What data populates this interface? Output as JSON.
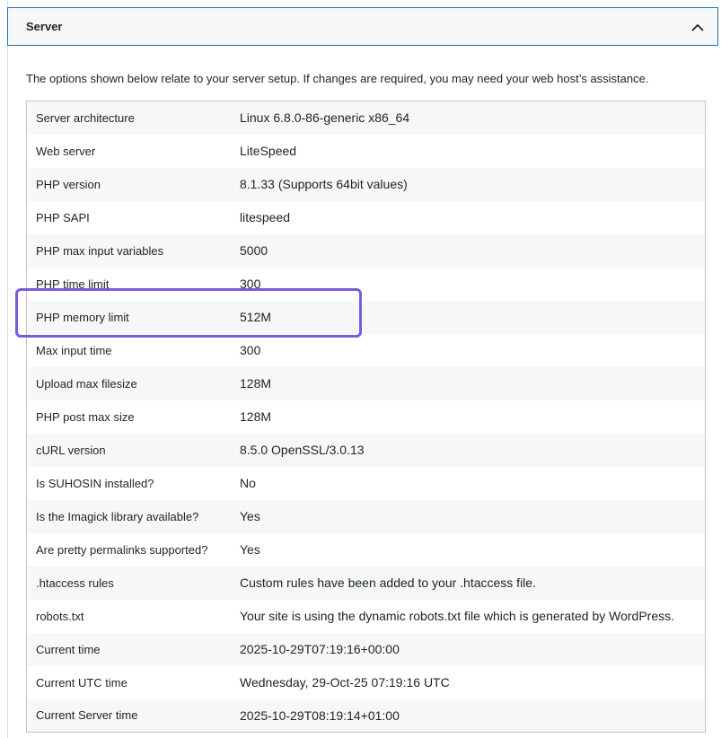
{
  "section": {
    "title": "Server",
    "toggle_icon": "chevron-up-icon"
  },
  "description": "The options shown below relate to your server setup. If changes are required, you may need your web host’s assistance.",
  "rows": [
    {
      "label": "Server architecture",
      "value": "Linux 6.8.0-86-generic x86_64"
    },
    {
      "label": "Web server",
      "value": "LiteSpeed"
    },
    {
      "label": "PHP version",
      "value": "8.1.33 (Supports 64bit values)"
    },
    {
      "label": "PHP SAPI",
      "value": "litespeed"
    },
    {
      "label": "PHP max input variables",
      "value": "5000"
    },
    {
      "label": "PHP time limit",
      "value": "300"
    },
    {
      "label": "PHP memory limit",
      "value": "512M"
    },
    {
      "label": "Max input time",
      "value": "300"
    },
    {
      "label": "Upload max filesize",
      "value": "128M"
    },
    {
      "label": "PHP post max size",
      "value": "128M"
    },
    {
      "label": "cURL version",
      "value": "8.5.0 OpenSSL/3.0.13"
    },
    {
      "label": "Is SUHOSIN installed?",
      "value": "No"
    },
    {
      "label": "Is the Imagick library available?",
      "value": "Yes"
    },
    {
      "label": "Are pretty permalinks supported?",
      "value": "Yes"
    },
    {
      "label": ".htaccess rules",
      "value": "Custom rules have been added to your .htaccess file."
    },
    {
      "label": "robots.txt",
      "value": "Your site is using the dynamic robots.txt file which is generated by WordPress."
    },
    {
      "label": "Current time",
      "value": "2025-10-29T07:19:16+00:00"
    },
    {
      "label": "Current UTC time",
      "value": "Wednesday, 29-Oct-25 07:19:16 UTC"
    },
    {
      "label": "Current Server time",
      "value": "2025-10-29T08:19:14+01:00"
    }
  ],
  "colors": {
    "highlight": "#7a5cdb",
    "header_border": "#2271b1",
    "row_alt": "#f6f7f7"
  }
}
